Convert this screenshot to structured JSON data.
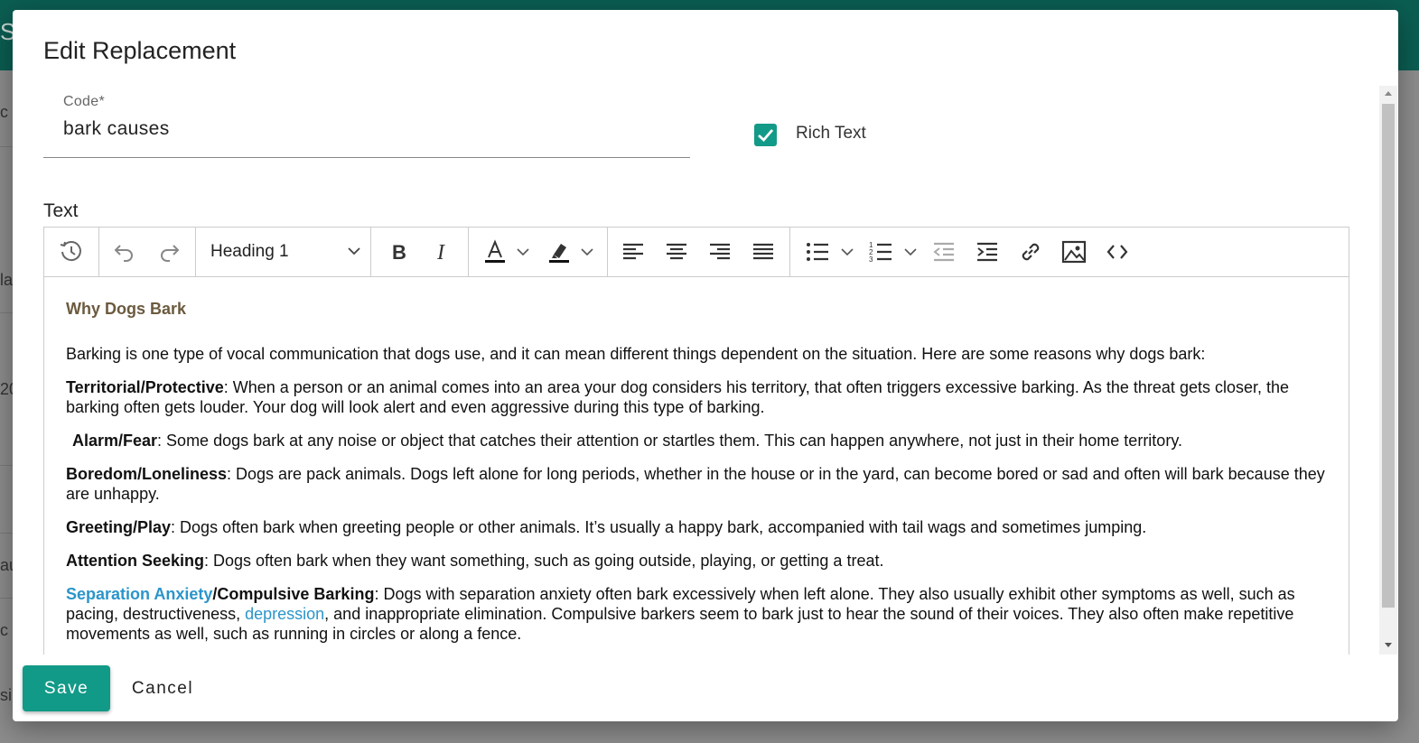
{
  "background": {
    "header_fragment": "S",
    "fragments": [
      "c",
      "la",
      "20",
      "au",
      "c",
      "si"
    ]
  },
  "dialog": {
    "title": "Edit Replacement",
    "code": {
      "label": "Code*",
      "value": "bark causes"
    },
    "rich_text": {
      "label": "Rich Text",
      "checked": true
    },
    "text_label": "Text"
  },
  "toolbar": {
    "heading_value": "Heading 1",
    "icons": [
      "history-icon",
      "undo-icon",
      "redo-icon",
      "bold-icon",
      "italic-icon",
      "font-color-icon",
      "highlight-icon",
      "align-left-icon",
      "align-center-icon",
      "align-right-icon",
      "justify-icon",
      "bullet-list-icon",
      "numbered-list-icon",
      "outdent-icon",
      "indent-icon",
      "link-icon",
      "image-icon",
      "source-code-icon"
    ]
  },
  "content": {
    "heading": "Why Dogs Bark",
    "intro": "Barking is one type of vocal communication that dogs use, and it can mean different things dependent on the situation. Here are some reasons why dogs bark:",
    "items": [
      {
        "term": "Territorial/Protective",
        "text": ": When a person or an animal comes into an area your dog considers his territory, that often triggers excessive barking. As the threat gets closer, the barking often gets louder. Your dog will look alert and even aggressive during this type of barking."
      },
      {
        "term": "Alarm/Fear",
        "text": ": Some dogs bark at any noise or object that catches their attention or startles them. This can happen anywhere, not just in their home territory."
      },
      {
        "term": "Boredom/Loneliness",
        "text": ": Dogs are pack animals. Dogs left alone for long periods, whether in the house or in the yard, can become bored or sad and often will bark because they are unhappy."
      },
      {
        "term": "Greeting/Play",
        "text": ": Dogs often bark when greeting people or other animals. It’s usually a happy bark, accompanied with tail wags and sometimes jumping."
      },
      {
        "term": "Attention Seeking",
        "text": ": Dogs often bark when they want something, such as going outside, playing, or getting a treat."
      }
    ],
    "last": {
      "link_term": "Separation Anxiety",
      "term_rest": "/Compulsive Barking",
      "text_a": ": Dogs with separation anxiety often bark excessively when left alone. They also usually exhibit other symptoms as well, such as pacing, destructiveness, ",
      "link_word": "depression",
      "text_b": ", and inappropriate elimination. Compulsive barkers seem to bark just to hear the sound of their voices. They also often make repetitive movements as well, such as running in circles or along a fence."
    }
  },
  "actions": {
    "save": "Save",
    "cancel": "Cancel"
  },
  "colors": {
    "accent": "#129a88",
    "header": "#0b5d52",
    "heading_text": "#6b5a3e",
    "link": "#2b95c9"
  }
}
